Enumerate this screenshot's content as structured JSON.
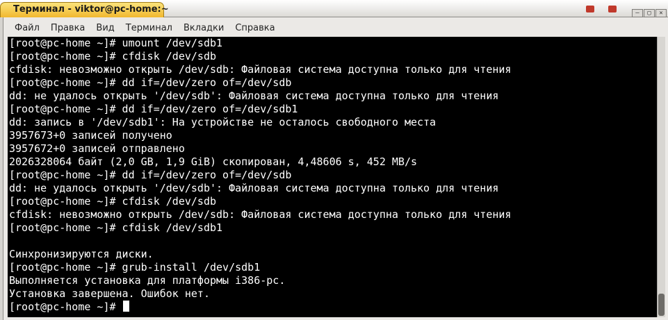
{
  "window": {
    "title": "Терминал - viktor@pc-home:~"
  },
  "menubar": [
    "Файл",
    "Правка",
    "Вид",
    "Терминал",
    "Вкладки",
    "Справка"
  ],
  "controls": {
    "minimize_icon": "–",
    "maximize_icon": "▢",
    "close_icon": "✕"
  },
  "terminal": {
    "lines": [
      "[root@pc-home ~]# umount /dev/sdb1",
      "[root@pc-home ~]# cfdisk /dev/sdb",
      "cfdisk: невозможно открыть /dev/sdb: Файловая система доступна только для чтения",
      "[root@pc-home ~]# dd if=/dev/zero of=/dev/sdb",
      "dd: не удалось открыть '/dev/sdb': Файловая система доступна только для чтения",
      "[root@pc-home ~]# dd if=/dev/zero of=/dev/sdb1",
      "dd: запись в '/dev/sdb1': На устройстве не осталось свободного места",
      "3957673+0 записей получено",
      "3957672+0 записей отправлено",
      "2026328064 байт (2,0 GB, 1,9 GiB) скопирован, 4,48606 s, 452 MB/s",
      "[root@pc-home ~]# dd if=/dev/zero of=/dev/sdb",
      "dd: не удалось открыть '/dev/sdb': Файловая система доступна только для чтения",
      "[root@pc-home ~]# cfdisk /dev/sdb",
      "cfdisk: невозможно открыть /dev/sdb: Файловая система доступна только для чтения",
      "[root@pc-home ~]# cfdisk /dev/sdb1",
      "",
      "Синхронизируются диски.",
      "[root@pc-home ~]# grub-install /dev/sdb1",
      "Выполняется установка для платформы i386-pc.",
      "Установка завершена. Ошибок нет."
    ],
    "prompt": "[root@pc-home ~]# "
  },
  "colors": {
    "title_tab": "#f1b82f",
    "terminal_bg": "#000000",
    "terminal_fg": "#ffffff"
  }
}
